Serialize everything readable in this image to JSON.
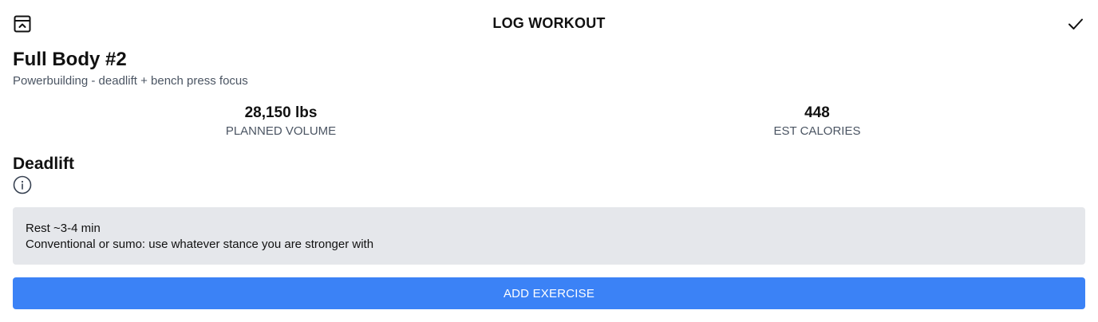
{
  "header": {
    "title": "LOG WORKOUT",
    "left_icon": "collapse-panel-icon",
    "right_icon": "check-icon"
  },
  "workout": {
    "title": "Full Body #2",
    "subtitle": "Powerbuilding - deadlift + bench press focus"
  },
  "stats": [
    {
      "value": "28,150 lbs",
      "label": "PLANNED VOLUME"
    },
    {
      "value": "448",
      "label": "EST CALORIES"
    }
  ],
  "exercise": {
    "name": "Deadlift",
    "info_icon": "info-icon",
    "notes": [
      "Rest ~3-4 min",
      "Conventional or sumo: use whatever stance you are stronger with"
    ]
  },
  "actions": {
    "add_exercise_label": "ADD EXERCISE"
  },
  "colors": {
    "accent": "#3b82f6",
    "notes_bg": "#e5e7eb",
    "muted_text": "#4b5563"
  }
}
